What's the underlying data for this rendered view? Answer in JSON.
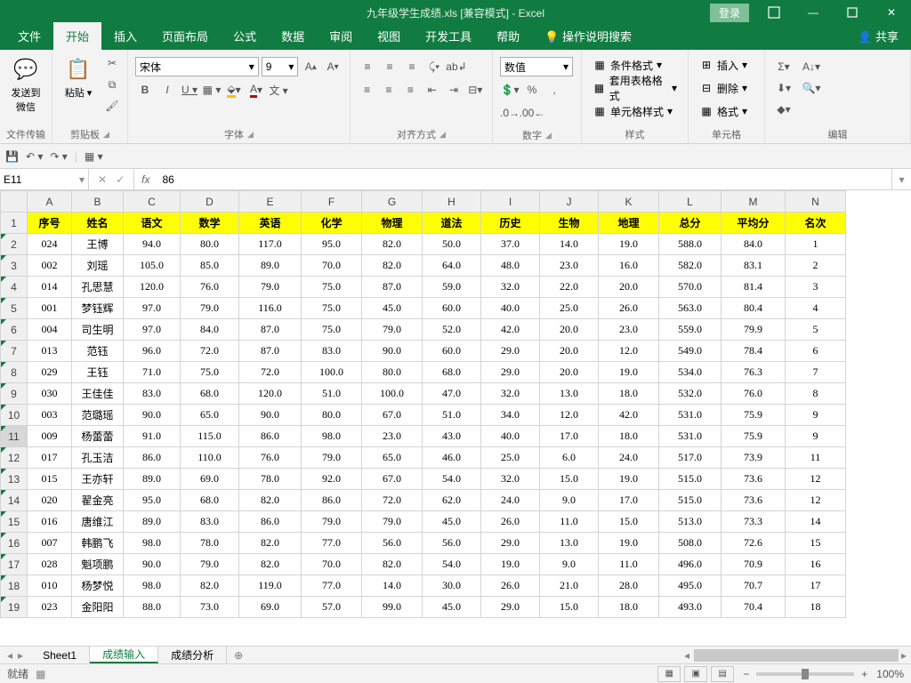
{
  "title": "九年级学生成绩.xls  [兼容模式]  -  Excel",
  "login": "登录",
  "tabs": {
    "file": "文件",
    "home": "开始",
    "insert": "插入",
    "layout": "页面布局",
    "formula": "公式",
    "data": "数据",
    "review": "审阅",
    "view": "视图",
    "dev": "开发工具",
    "help": "帮助",
    "tell": "操作说明搜索",
    "share": "共享"
  },
  "ribbon": {
    "wechat": {
      "btn": "发送到微信",
      "group": "文件传输"
    },
    "clipboard": {
      "paste": "粘贴",
      "group": "剪贴板"
    },
    "font": {
      "name": "宋体",
      "size": "9",
      "group": "字体"
    },
    "align": {
      "group": "对齐方式"
    },
    "number": {
      "format": "数值",
      "group": "数字"
    },
    "styles": {
      "cond": "条件格式",
      "tablefmt": "套用表格格式",
      "cellfmt": "单元格样式",
      "group": "样式"
    },
    "cells": {
      "insert": "插入",
      "delete": "删除",
      "format": "格式",
      "group": "单元格"
    },
    "editing": {
      "group": "编辑"
    }
  },
  "name_box": "E11",
  "formula": "86",
  "cols": [
    "A",
    "B",
    "C",
    "D",
    "E",
    "F",
    "G",
    "H",
    "I",
    "J",
    "K",
    "L",
    "M",
    "N"
  ],
  "header_row": [
    "序号",
    "姓名",
    "语文",
    "数学",
    "英语",
    "化学",
    "物理",
    "道法",
    "历史",
    "生物",
    "地理",
    "总分",
    "平均分",
    "名次"
  ],
  "rows": [
    [
      "024",
      "王博",
      "94.0",
      "80.0",
      "117.0",
      "95.0",
      "82.0",
      "50.0",
      "37.0",
      "14.0",
      "19.0",
      "588.0",
      "84.0",
      "1"
    ],
    [
      "002",
      "刘瑶",
      "105.0",
      "85.0",
      "89.0",
      "70.0",
      "82.0",
      "64.0",
      "48.0",
      "23.0",
      "16.0",
      "582.0",
      "83.1",
      "2"
    ],
    [
      "014",
      "孔思慧",
      "120.0",
      "76.0",
      "79.0",
      "75.0",
      "87.0",
      "59.0",
      "32.0",
      "22.0",
      "20.0",
      "570.0",
      "81.4",
      "3"
    ],
    [
      "001",
      "梦钰辉",
      "97.0",
      "79.0",
      "116.0",
      "75.0",
      "45.0",
      "60.0",
      "40.0",
      "25.0",
      "26.0",
      "563.0",
      "80.4",
      "4"
    ],
    [
      "004",
      "司生明",
      "97.0",
      "84.0",
      "87.0",
      "75.0",
      "79.0",
      "52.0",
      "42.0",
      "20.0",
      "23.0",
      "559.0",
      "79.9",
      "5"
    ],
    [
      "013",
      "范钰",
      "96.0",
      "72.0",
      "87.0",
      "83.0",
      "90.0",
      "60.0",
      "29.0",
      "20.0",
      "12.0",
      "549.0",
      "78.4",
      "6"
    ],
    [
      "029",
      "王钰",
      "71.0",
      "75.0",
      "72.0",
      "100.0",
      "80.0",
      "68.0",
      "29.0",
      "20.0",
      "19.0",
      "534.0",
      "76.3",
      "7"
    ],
    [
      "030",
      "王佳佳",
      "83.0",
      "68.0",
      "120.0",
      "51.0",
      "100.0",
      "47.0",
      "32.0",
      "13.0",
      "18.0",
      "532.0",
      "76.0",
      "8"
    ],
    [
      "003",
      "范璐瑶",
      "90.0",
      "65.0",
      "90.0",
      "80.0",
      "67.0",
      "51.0",
      "34.0",
      "12.0",
      "42.0",
      "531.0",
      "75.9",
      "9"
    ],
    [
      "009",
      "杨蕾蕾",
      "91.0",
      "115.0",
      "86.0",
      "98.0",
      "23.0",
      "43.0",
      "40.0",
      "17.0",
      "18.0",
      "531.0",
      "75.9",
      "9"
    ],
    [
      "017",
      "孔玉洁",
      "86.0",
      "110.0",
      "76.0",
      "79.0",
      "65.0",
      "46.0",
      "25.0",
      "6.0",
      "24.0",
      "517.0",
      "73.9",
      "11"
    ],
    [
      "015",
      "王亦轩",
      "89.0",
      "69.0",
      "78.0",
      "92.0",
      "67.0",
      "54.0",
      "32.0",
      "15.0",
      "19.0",
      "515.0",
      "73.6",
      "12"
    ],
    [
      "020",
      "翟金亮",
      "95.0",
      "68.0",
      "82.0",
      "86.0",
      "72.0",
      "62.0",
      "24.0",
      "9.0",
      "17.0",
      "515.0",
      "73.6",
      "12"
    ],
    [
      "016",
      "唐维江",
      "89.0",
      "83.0",
      "86.0",
      "79.0",
      "79.0",
      "45.0",
      "26.0",
      "11.0",
      "15.0",
      "513.0",
      "73.3",
      "14"
    ],
    [
      "007",
      "韩鹏飞",
      "98.0",
      "78.0",
      "82.0",
      "77.0",
      "56.0",
      "56.0",
      "29.0",
      "13.0",
      "19.0",
      "508.0",
      "72.6",
      "15"
    ],
    [
      "028",
      "魁项鹏",
      "90.0",
      "79.0",
      "82.0",
      "70.0",
      "82.0",
      "54.0",
      "19.0",
      "9.0",
      "11.0",
      "496.0",
      "70.9",
      "16"
    ],
    [
      "010",
      "杨梦悦",
      "98.0",
      "82.0",
      "119.0",
      "77.0",
      "14.0",
      "30.0",
      "26.0",
      "21.0",
      "28.0",
      "495.0",
      "70.7",
      "17"
    ],
    [
      "023",
      "金阳阳",
      "88.0",
      "73.0",
      "69.0",
      "57.0",
      "99.0",
      "45.0",
      "29.0",
      "15.0",
      "18.0",
      "493.0",
      "70.4",
      "18"
    ]
  ],
  "sheets": {
    "s1": "Sheet1",
    "s2": "成绩输入",
    "s3": "成绩分析"
  },
  "status": {
    "ready": "就绪",
    "zoom": "100%"
  }
}
